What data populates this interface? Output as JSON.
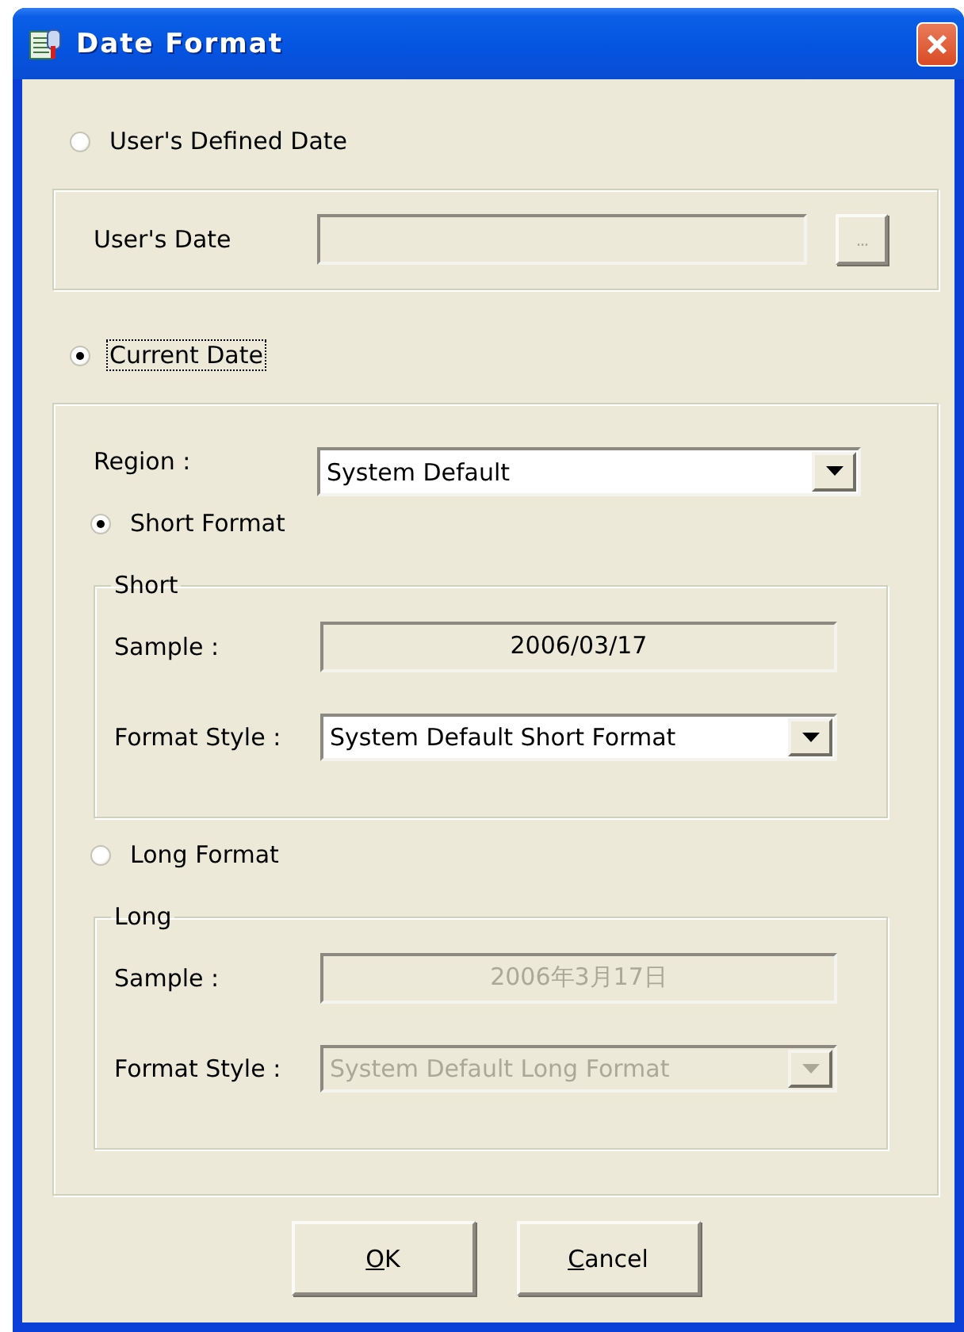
{
  "window": {
    "title": "Date Format"
  },
  "user_defined": {
    "option": {
      "label": "User's Defined Date",
      "selected": false,
      "focused": false
    },
    "date_label": "User's Date",
    "date_field": {
      "disabled": true
    },
    "browse_button": {
      "label": "...",
      "disabled": true
    }
  },
  "current_date": {
    "option": {
      "label": "Current Date",
      "selected": true,
      "focused": true
    },
    "region": {
      "label": "Region :",
      "value": "System Default",
      "disabled": false
    },
    "short": {
      "option": {
        "label": "Short Format",
        "selected": true,
        "focused": false
      },
      "group_title": "Short",
      "sample_label": "Sample :",
      "sample": {
        "value": "2006/03/17",
        "disabled": false
      },
      "style_label": "Format Style :",
      "style": {
        "value": "System Default Short Format",
        "disabled": false
      }
    },
    "long": {
      "option": {
        "label": "Long Format",
        "selected": false,
        "focused": false
      },
      "group_title": "Long",
      "sample_label": "Sample :",
      "sample": {
        "value": "2006年3月17日",
        "disabled": true
      },
      "style_label": "Format Style :",
      "style": {
        "value": "System Default Long Format",
        "disabled": true
      }
    }
  },
  "buttons": [
    {
      "label": "OK"
    },
    {
      "label": "Cancel"
    }
  ]
}
